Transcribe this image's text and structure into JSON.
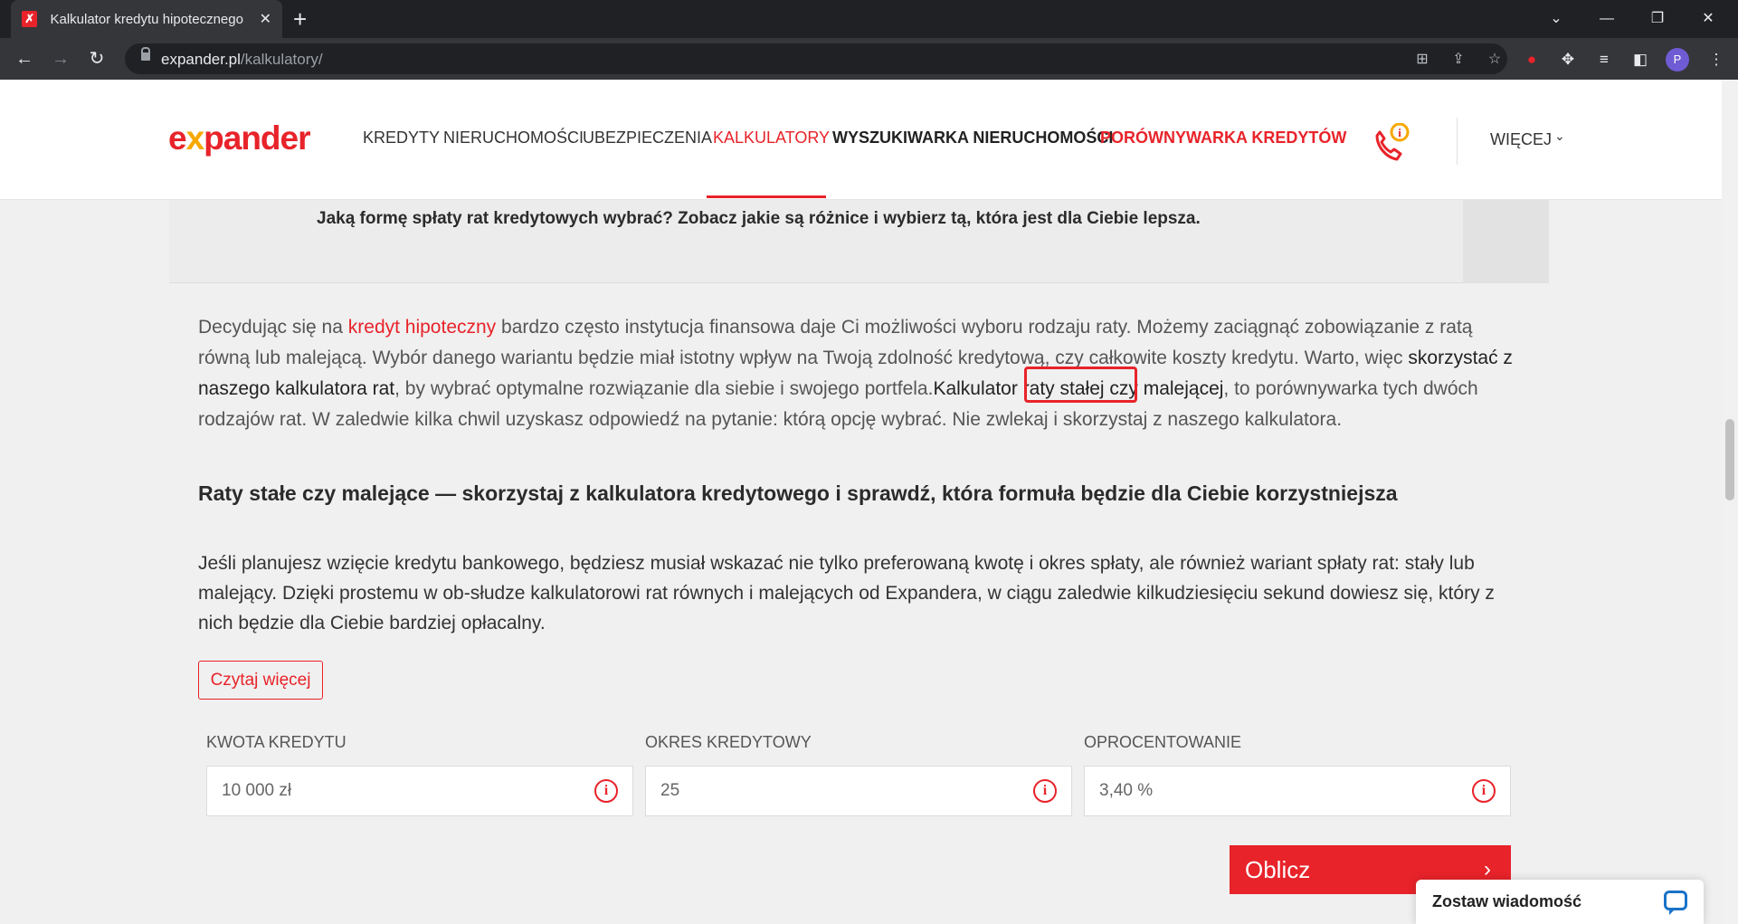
{
  "browser": {
    "tab_title": "Kalkulator kredytu hipotecznego",
    "tab_close": "✕",
    "new_tab": "+",
    "url_domain": "expander.pl",
    "url_path": "/kalkulatory/",
    "profile_initial": "P"
  },
  "header": {
    "logo_ex": "e",
    "logo_x": "x",
    "logo_rest": "pander",
    "nav": [
      "KREDYTY",
      "NIERUCHOMOŚCI",
      "UBEZPIECZENIA",
      "KALKULATORY",
      "WYSZUKIWARKA NIERUCHOMOŚCI",
      "PORÓWNYWARKA KREDYTÓW"
    ],
    "more_label": "WIĘCEJ"
  },
  "content": {
    "question": "Jaką formę spłaty rat kredytowych wybrać? Zobacz jakie są różnice i wybierz tą, która jest dla Ciebie lepsza.",
    "intro_1": "Decydując się na ",
    "intro_link": "kredyt hipoteczny",
    "intro_2": " bardzo często instytucja finansowa daje Ci możliwości wyboru rodzaju raty. Możemy  zaciągnąć zobowiązanie z ratą równą lub malejącą. Wybór danego wariantu będzie miał istotny wpływ na Twoją zdolność kredytową, czy całkowite koszty kredytu. Warto, więc ",
    "intro_bold_1": "skorzystać z naszego kalkulatora rat",
    "intro_3": ", by wybrać optymalne rozwiązanie dla siebie i swojego portfela.",
    "intro_bold_2": "Kalkulator raty stałej czy malejącej",
    "intro_4": ", to porównywarka tych dwóch rodzajów rat. W zaledwie kilka chwil uzyskasz odpowiedź na pytanie: którą opcję wybrać. Nie zwlekaj i skorzystaj z naszego kalkulatora.",
    "heading": "Raty stałe czy malejące — skorzystaj z kalkulatora kredytowego i sprawdź, która formuła będzie dla Ciebie korzystniejsza",
    "paragraph": "Jeśli planujesz wzięcie kredytu bankowego, będziesz musiał wskazać nie tylko preferowaną kwotę i okres spłaty, ale również wariant spłaty rat: stały lub malejący. Dzięki prostemu w ob-słudze kalkulatorowi rat równych i malejących od Expandera, w ciągu zaledwie kilkudziesięciu sekund dowiesz się, który z nich będzie dla Ciebie bardziej opłacalny.",
    "read_more": "Czytaj więcej"
  },
  "calculator": {
    "fields": [
      {
        "label": "KWOTA KREDYTU",
        "value": "10 000 zł"
      },
      {
        "label": "OKRES KREDYTOWY",
        "value": "25"
      },
      {
        "label": "OPROCENTOWANIE",
        "value": "3,40 %"
      }
    ],
    "info_glyph": "i",
    "submit": "Oblicz",
    "submit_chevron": "›"
  },
  "chat": {
    "label": "Zostaw wiadomość"
  },
  "colors": {
    "brand_red": "#e8232a",
    "brand_orange": "#f6a800"
  }
}
